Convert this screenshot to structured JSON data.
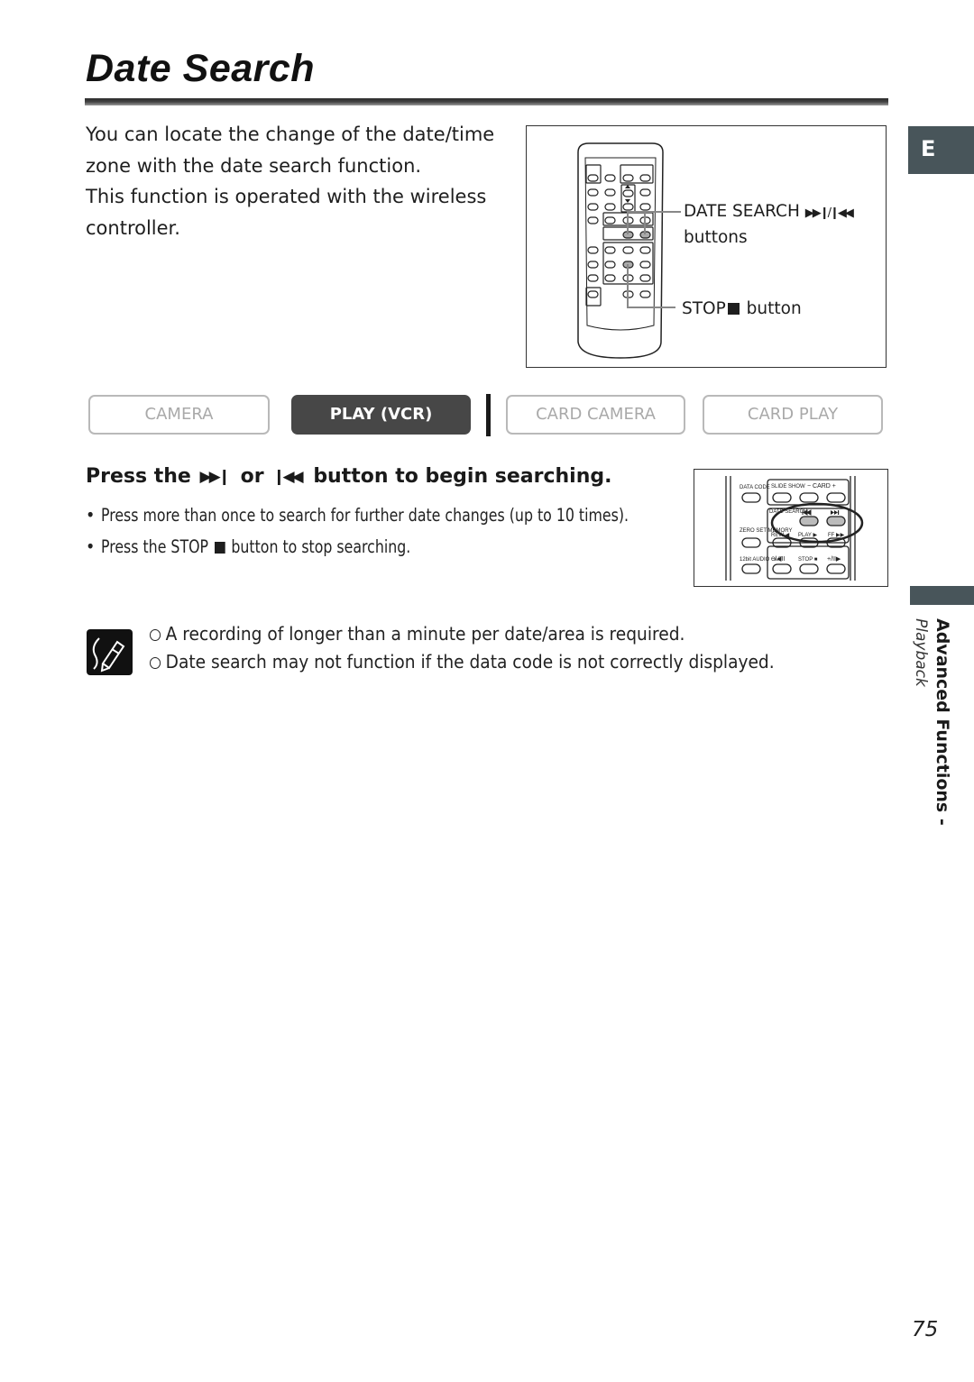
{
  "page": {
    "title": "Date Search",
    "language_tab": "E",
    "section_main": "Advanced Functions -",
    "section_sub": "Playback",
    "page_number": "75"
  },
  "intro": {
    "line1": "You can locate the change of the date/time zone with the date search function.",
    "line2": "This function is operated with the wireless controller."
  },
  "remote_figure": {
    "date_search_label": "DATE SEARCH",
    "date_search_glyph": "▶▶❙/❙◀◀",
    "date_search_suffix": "buttons",
    "stop_label_prefix": "STOP",
    "stop_label_suffix": "button"
  },
  "modes": {
    "items": [
      {
        "label": "CAMERA",
        "active": false
      },
      {
        "label": "PLAY (VCR)",
        "active": true
      },
      {
        "label": "CARD CAMERA",
        "active": false
      },
      {
        "label": "CARD PLAY",
        "active": false
      }
    ]
  },
  "step": {
    "head_prefix": "Press the",
    "head_ff_glyph": "▶▶❙",
    "head_or": "or",
    "head_rew_glyph": "❙◀◀",
    "head_suffix": "button to begin searching.",
    "bullet1": "Press more than once to search for further date changes (up to 10 times).",
    "bullet2_prefix": "Press the STOP",
    "bullet2_suffix": "button to stop searching."
  },
  "detail_figure": {
    "labels": {
      "data_code": "DATA CODE",
      "slide_show": "SLIDE SHOW",
      "card": "− CARD +",
      "date_search": "DATE SEARCH",
      "zero_set": "ZERO SET MEMORY",
      "rew": "REW ◀",
      "play": "PLAY ▶",
      "ff": "FF ▶▶",
      "audio_out": "12bit AUDIO OUT",
      "slow_minus": "−/◀II",
      "stop": "STOP ■",
      "slow_plus": "+/II▶"
    }
  },
  "notes": {
    "items": [
      "A recording of longer than a minute per date/area is required.",
      "Date search may not function if the data code is not correctly displayed."
    ]
  }
}
